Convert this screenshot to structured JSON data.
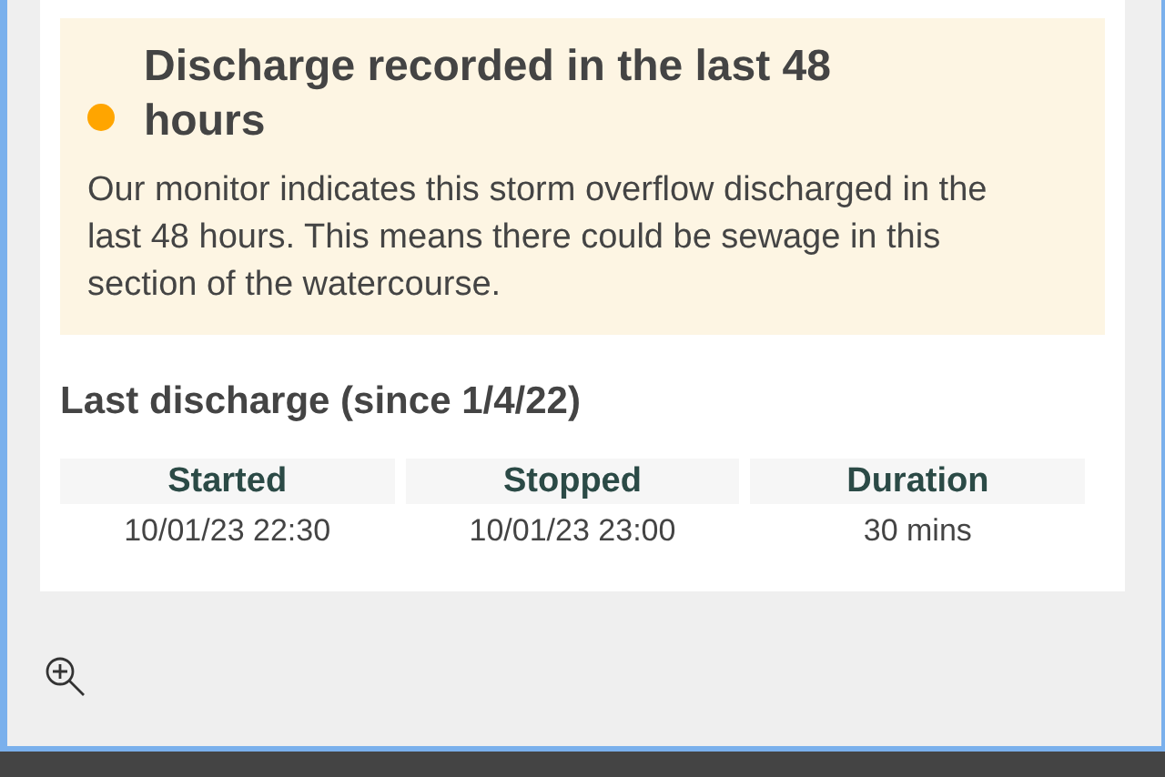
{
  "alert": {
    "color": "#ffa500",
    "title": "Discharge recorded in the last 48 hours",
    "body": "Our monitor indicates this storm overflow discharged in the last 48 hours. This means there could be sewage in this section of the watercourse."
  },
  "last_discharge": {
    "heading": "Last discharge (since 1/4/22)",
    "columns": [
      "Started",
      "Stopped",
      "Duration"
    ],
    "values": [
      "10/01/23 22:30",
      "10/01/23 23:00",
      "30 mins"
    ]
  }
}
